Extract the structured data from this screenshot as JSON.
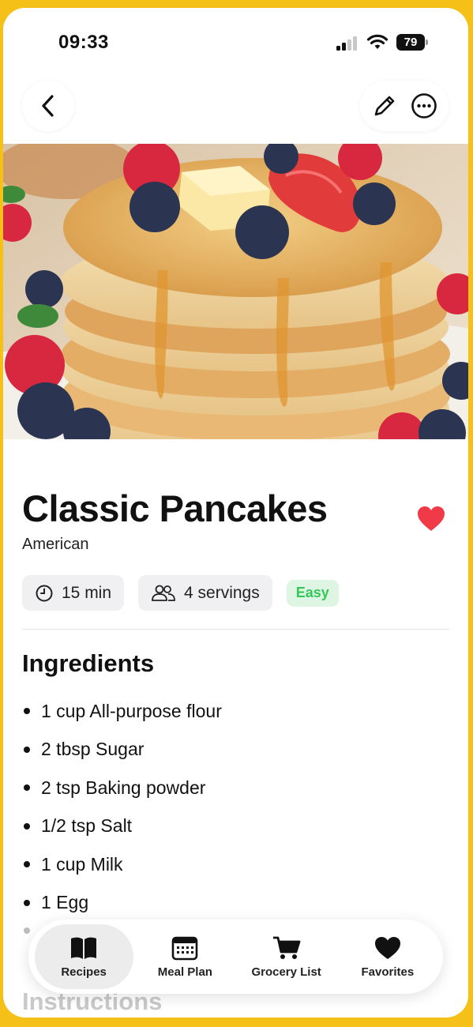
{
  "status_bar": {
    "time": "09:33",
    "battery": "79"
  },
  "nav": {
    "back_icon": "chevron-left-icon",
    "edit_icon": "pencil-icon",
    "more_icon": "ellipsis-circle-icon"
  },
  "recipe": {
    "title": "Classic Pancakes",
    "cuisine": "American",
    "time": "15 min",
    "servings": "4 servings",
    "difficulty": "Easy",
    "is_favorite": true
  },
  "ingredients_title": "Ingredients",
  "ingredients": [
    "1 cup All-purpose flour",
    "2 tbsp Sugar",
    "2 tsp Baking powder",
    "1/2 tsp Salt",
    "1 cup Milk",
    "1 Egg"
  ],
  "instructions_title": "Instructions",
  "tabs": [
    {
      "label": "Recipes",
      "icon": "book-icon",
      "active": true
    },
    {
      "label": "Meal Plan",
      "icon": "calendar-icon",
      "active": false
    },
    {
      "label": "Grocery List",
      "icon": "cart-icon",
      "active": false
    },
    {
      "label": "Favorites",
      "icon": "heart-icon",
      "active": false
    }
  ],
  "colors": {
    "frame": "#f5c118",
    "heart": "#f03a47",
    "easy_text": "#34c759",
    "easy_bg": "#dff5e3",
    "chip_bg": "#f0f0f3"
  }
}
